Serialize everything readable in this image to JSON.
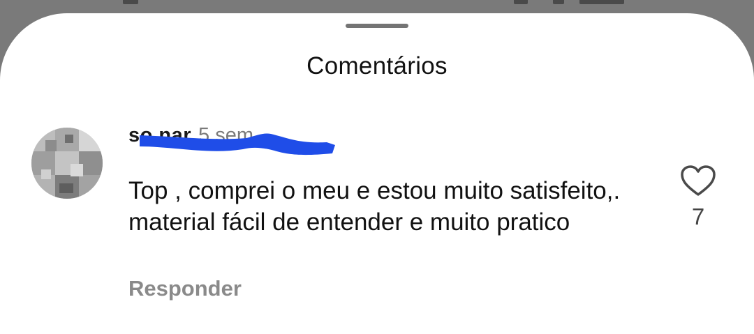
{
  "sheet": {
    "title": "Comentários"
  },
  "comment": {
    "username": "so                    nar",
    "time_ago": "5 sem",
    "text": "Top , comprei o meu e estou muito satisfeito,. material fácil de entender e muito pratico",
    "reply_label": "Responder",
    "like_count": "7",
    "like_icon": "heart-outline-icon"
  },
  "colors": {
    "backdrop": "#7a7a7a",
    "sheet": "#ffffff",
    "redaction": "#1f4de8"
  }
}
